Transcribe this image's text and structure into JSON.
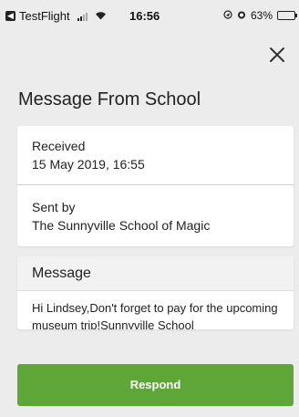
{
  "status_bar": {
    "back_app_label": "TestFlight",
    "time": "16:56",
    "battery": "63%",
    "battery_level": 0.63,
    "icons": [
      "back-to-app-icon",
      "signal-icon",
      "wifi-icon",
      "location-icon",
      "alarm-icon",
      "battery-icon"
    ]
  },
  "header": {
    "title": "Message From School",
    "close_icon": "close-icon"
  },
  "details": {
    "received_label": "Received",
    "received_value": "15 May 2019, 16:55",
    "sent_by_label": "Sent by",
    "sent_by_value": "The Sunnyville School of Magic"
  },
  "message": {
    "header": "Message",
    "body": "Hi Lindsey,Don't forget to pay for the upcoming museum trip!Sunnyville School"
  },
  "actions": {
    "respond_label": "Respond"
  },
  "colors": {
    "background": "#ececec",
    "card": "#ffffff",
    "accent_green": "#5fa639"
  }
}
